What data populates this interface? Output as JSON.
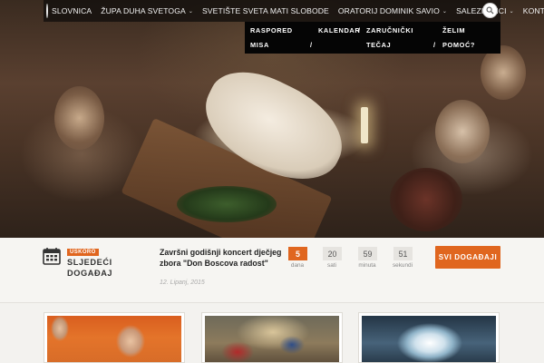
{
  "nav": {
    "logo_label": "Slovnica",
    "items": [
      {
        "label": "SLOVNICA"
      },
      {
        "label": "ŽUPA DUHA SVETOGA",
        "has_dropdown": true
      },
      {
        "label": "SVETIŠTE SVETA MATI SLOBODE",
        "has_dropdown": false
      },
      {
        "label": "ORATORIJ DOMINIK SAVIO",
        "has_dropdown": true
      },
      {
        "label": "SALEZIJANCI",
        "has_dropdown": true
      },
      {
        "label": "KONT",
        "has_dropdown": false
      }
    ],
    "search_icon": "search-icon"
  },
  "dropdown": {
    "items": [
      {
        "line1": "RASPORED",
        "line2": "MISA"
      },
      {
        "line1": "KALENDAR",
        "line2": ""
      },
      {
        "line1": "ZARUČNIČKI",
        "line2": "TEČAJ"
      },
      {
        "line1": "ŽELIM",
        "line2": "POMOĆ?"
      }
    ],
    "separator": "/"
  },
  "events": {
    "badge": "USKORO",
    "label_line1": "SLJEDEĆI",
    "label_line2": "DOGAĐAJ",
    "title": "Završni godišnji koncert dječjeg zbora \"Don Boscova radost\"",
    "date": "12. Lipanj, 2015",
    "countdown": [
      {
        "value": "5",
        "unit": "dana"
      },
      {
        "value": "20",
        "unit": "sati"
      },
      {
        "value": "59",
        "unit": "minuta"
      },
      {
        "value": "51",
        "unit": "sekundi"
      }
    ],
    "all_events_label": "SVI DOGAĐAJI"
  },
  "colors": {
    "accent": "#e0661f",
    "nav_bg": "#141010",
    "dropdown_bg": "#050505"
  },
  "cards": [
    {
      "image": "pope-image"
    },
    {
      "image": "painting-image"
    },
    {
      "image": "dome-image"
    }
  ]
}
